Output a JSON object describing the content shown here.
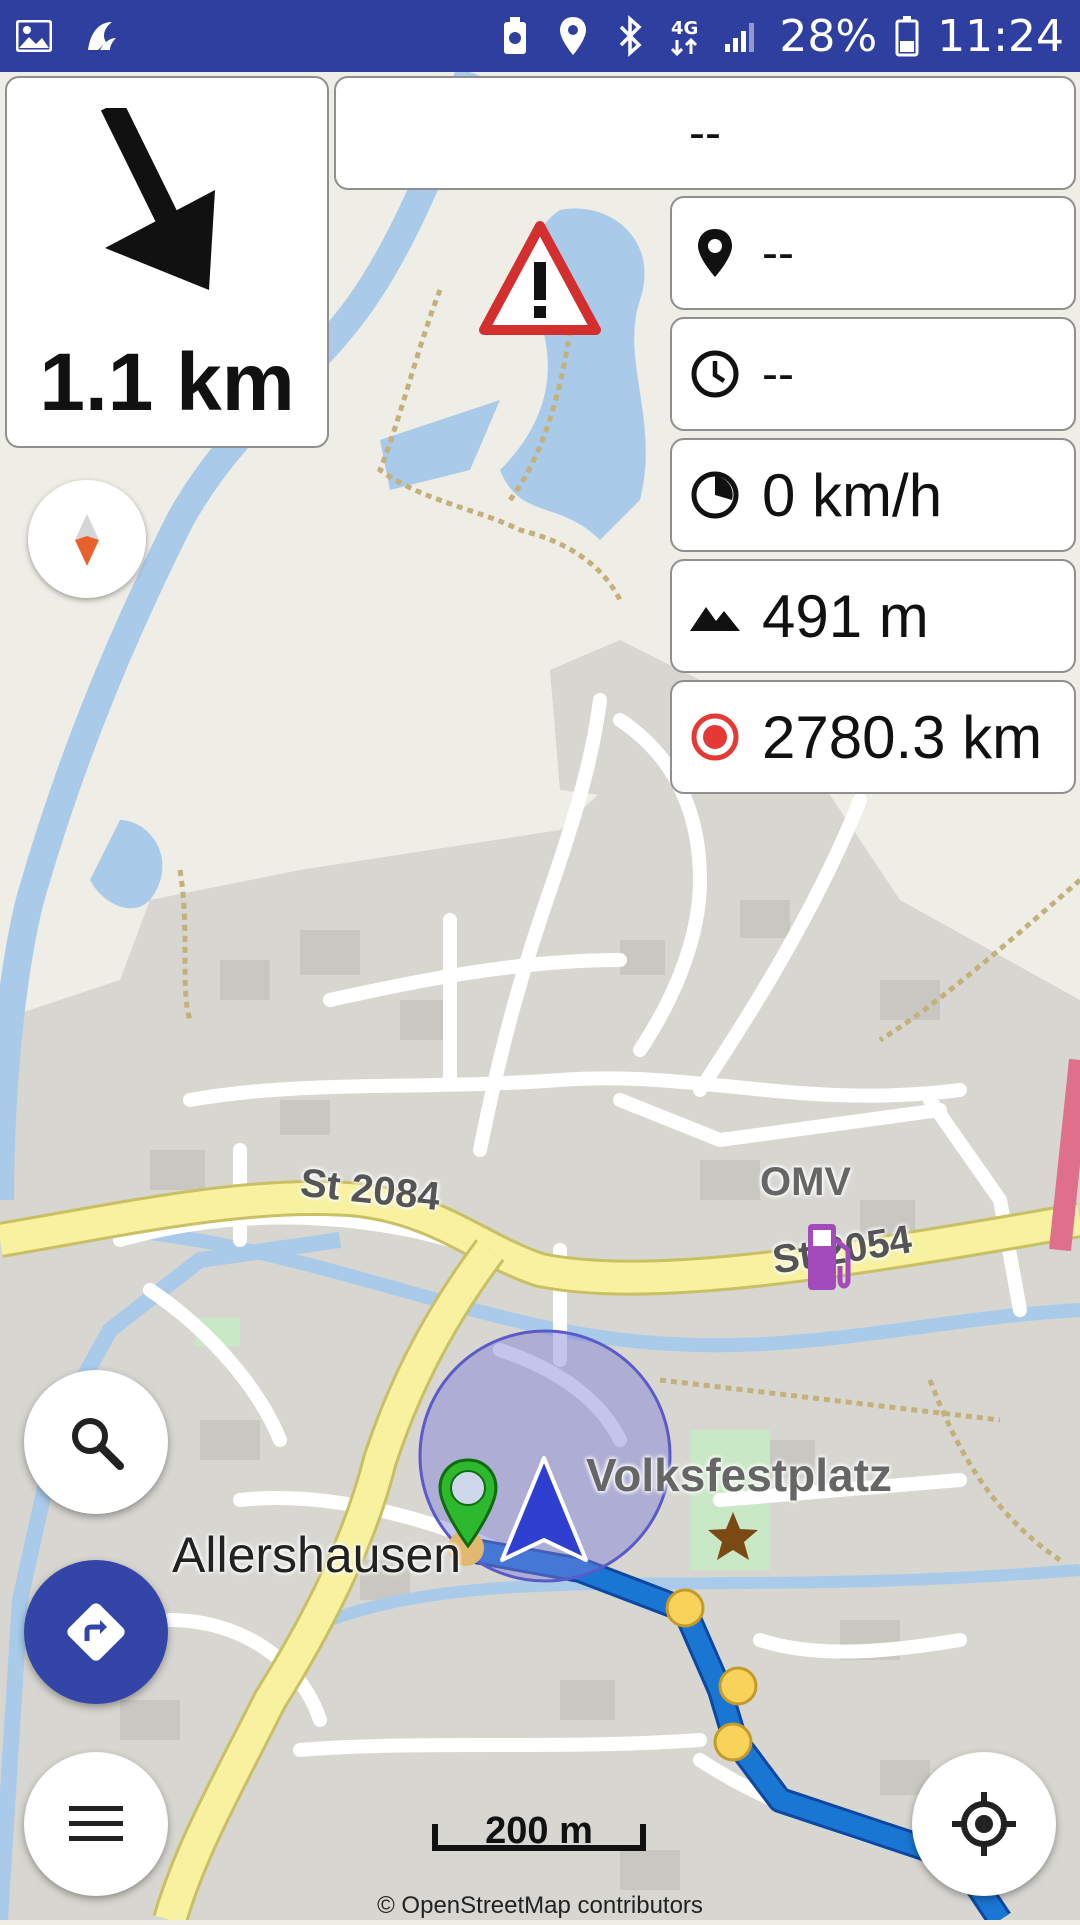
{
  "status_bar": {
    "battery": "28%",
    "time": "11:24",
    "network": "4G",
    "left_icons": [
      "image-icon",
      "app-icon"
    ],
    "right_icons": [
      "battery-saver-icon",
      "location-icon",
      "bluetooth-icon",
      "network-4g-icon",
      "signal-icon",
      "battery-icon"
    ]
  },
  "navigation": {
    "next_turn_distance": "1.1 km",
    "next_turn_icon": "arrow-down-right-icon",
    "street": "--",
    "destination": "--",
    "arrival_time": "--",
    "speed": "0 km/h",
    "altitude": "491 m",
    "track_distance": "2780.3 km"
  },
  "map": {
    "labels": {
      "road_1": "St 2084",
      "road_2": "St 2054",
      "poi_fuel": "OMV",
      "place_town": "Allershausen",
      "place_square": "Volksfestplatz"
    },
    "scale": "200 m",
    "attribution": "© OpenStreetMap contributors",
    "colors": {
      "route": "#1976d2",
      "road_major": "#f7f1a0",
      "water": "#a9cbe9",
      "accent_blue": "#3346a8"
    }
  },
  "controls": {
    "search": "search-icon",
    "directions": "directions-icon",
    "menu": "menu-icon",
    "my_location": "my-location-icon",
    "compass": "compass-icon"
  }
}
